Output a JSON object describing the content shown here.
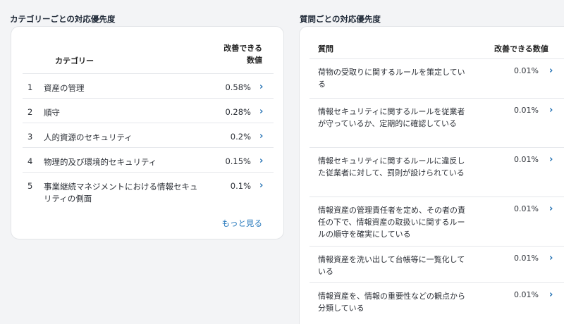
{
  "left": {
    "title": "カテゴリーごとの対応優先度",
    "header_category": "カテゴリー",
    "header_value_line1": "改善できる",
    "header_value_line2": "数値",
    "rows": [
      {
        "index": "1",
        "name": "資産の管理",
        "value": "0.58%"
      },
      {
        "index": "2",
        "name": "順守",
        "value": "0.28%"
      },
      {
        "index": "3",
        "name": "人的資源のセキュリティ",
        "value": "0.2%"
      },
      {
        "index": "4",
        "name": "物理的及び環境的セキュリティ",
        "value": "0.15%"
      },
      {
        "index": "5",
        "name": "事業継続マネジメントにおける情報セキュリティの側面",
        "value": "0.1%"
      }
    ],
    "more_link": "もっと見る"
  },
  "right": {
    "title": "質問ごとの対応優先度",
    "header_question": "質問",
    "header_value": "改善できる数値",
    "rows": [
      {
        "question": "荷物の受取りに関するルールを策定している",
        "value": "0.01%"
      },
      {
        "question": "情報セキュリティに関するルールを従業者が守っているか、定期的に確認している",
        "value": "0.01%"
      },
      {
        "question": "情報セキュリティに関するルールに違反した従業者に対して、罰則が設けられている",
        "value": "0.01%"
      },
      {
        "question": "情報資産の管理責任者を定め、その者の責任の下で、情報資産の取扱いに関するルールの順守を確実にしている",
        "value": "0.01%"
      },
      {
        "question": "情報資産を洗い出して台帳等に一覧化している",
        "value": "0.01%"
      },
      {
        "question": "情報資産を、情報の重要性などの観点から分類している",
        "value": "0.01%"
      }
    ]
  }
}
